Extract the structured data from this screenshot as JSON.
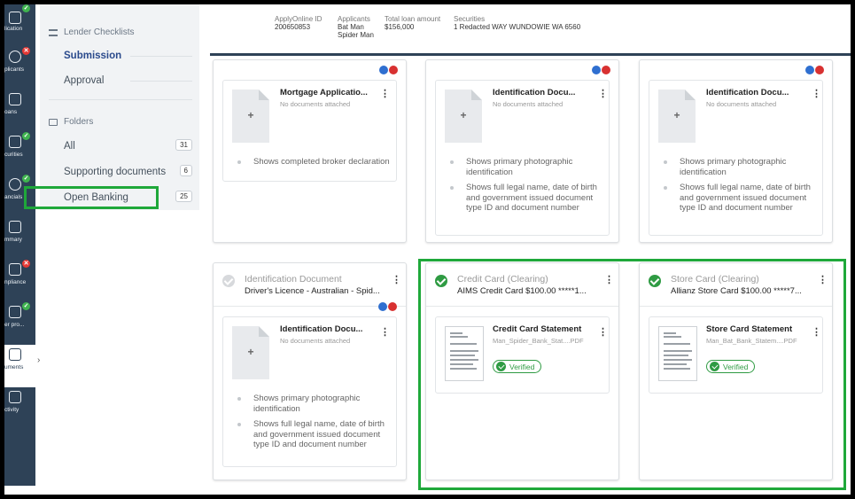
{
  "nav_rail": {
    "items": [
      {
        "label": "lication",
        "badge": "ok",
        "icon": "application-icon"
      },
      {
        "label": "plicants",
        "badge": "err",
        "icon": "applicants-icon"
      },
      {
        "label": "oans",
        "badge": "",
        "icon": "bank-icon"
      },
      {
        "label": "curities",
        "badge": "ok",
        "icon": "securities-icon"
      },
      {
        "label": "ancials",
        "badge": "ok",
        "icon": "dollar-icon"
      },
      {
        "label": "mmary",
        "badge": "",
        "icon": "summary-icon"
      },
      {
        "label": "npliance",
        "badge": "err",
        "icon": "gavel-icon"
      },
      {
        "label": "er pro...",
        "badge": "ok",
        "icon": "provider-icon"
      },
      {
        "label": "uments",
        "badge": "",
        "icon": "documents-icon",
        "active": true
      },
      {
        "label": "ctivity",
        "badge": "",
        "icon": "hourglass-icon"
      }
    ],
    "badge_ok_symbol": "✓",
    "badge_err_symbol": "✕",
    "expand_arrow": "›"
  },
  "checklist_panel": {
    "lender_checklists_label": "Lender Checklists",
    "submission_label": "Submission",
    "approval_label": "Approval",
    "folders_label": "Folders",
    "folders": [
      {
        "label": "All",
        "count": "31"
      },
      {
        "label": "Supporting documents",
        "count": "6"
      },
      {
        "label": "Open Banking",
        "count": "25"
      }
    ]
  },
  "header": {
    "applyonline_id_label": "ApplyOnline ID",
    "applyonline_id_value": "200650853",
    "applicants_label": "Applicants",
    "applicants_value_1": "Bat Man",
    "applicants_value_2": "Spider Man",
    "total_loan_label": "Total loan amount",
    "total_loan_value": "$156,000",
    "securities_label": "Securities",
    "securities_value": "1 Redacted WAY WUNDOWIE WA 6560"
  },
  "cards_top": [
    {
      "doc_title": "Mortgage Applicatio...",
      "doc_sub": "No documents attached",
      "bullets": [
        "Shows completed broker declaration"
      ]
    },
    {
      "doc_title": "Identification Docu...",
      "doc_sub": "No documents attached",
      "bullets": [
        "Shows primary photographic identification",
        "Shows full legal name, date of birth and government issued document type ID and document number"
      ]
    },
    {
      "doc_title": "Identification Docu...",
      "doc_sub": "No documents attached",
      "bullets": [
        "Shows primary photographic identification",
        "Shows full legal name, date of birth and government issued document type ID and document number"
      ]
    }
  ],
  "card_id_bottom": {
    "title": "Identification Document",
    "subtitle": "Driver's Licence - Australian - Spid...",
    "doc_title": "Identification Docu...",
    "doc_sub": "No documents attached",
    "bullets": [
      "Shows primary photographic identification",
      "Shows full legal name, date of birth and government issued document type ID and document number"
    ]
  },
  "card_credit": {
    "title": "Credit Card (Clearing)",
    "subtitle": "AIMS Credit Card $100.00 *****1...",
    "doc_title": "Credit Card Statement",
    "doc_sub": "Man_Spider_Bank_Stat....PDF",
    "verified_label": "Verified"
  },
  "card_store": {
    "title": "Store Card (Clearing)",
    "subtitle": "Allianz Store Card $100.00 *****7...",
    "doc_title": "Store Card Statement",
    "doc_sub": "Man_Bat_Bank_Statem....PDF",
    "verified_label": "Verified"
  },
  "glyphs": {
    "kebab": "⋮",
    "plus": "+"
  },
  "colors": {
    "nav": "#2e4257",
    "highlight": "#1fa83a",
    "verified": "#2f9b43",
    "applicant_blue": "#2f6fd0",
    "applicant_red": "#d83131"
  }
}
